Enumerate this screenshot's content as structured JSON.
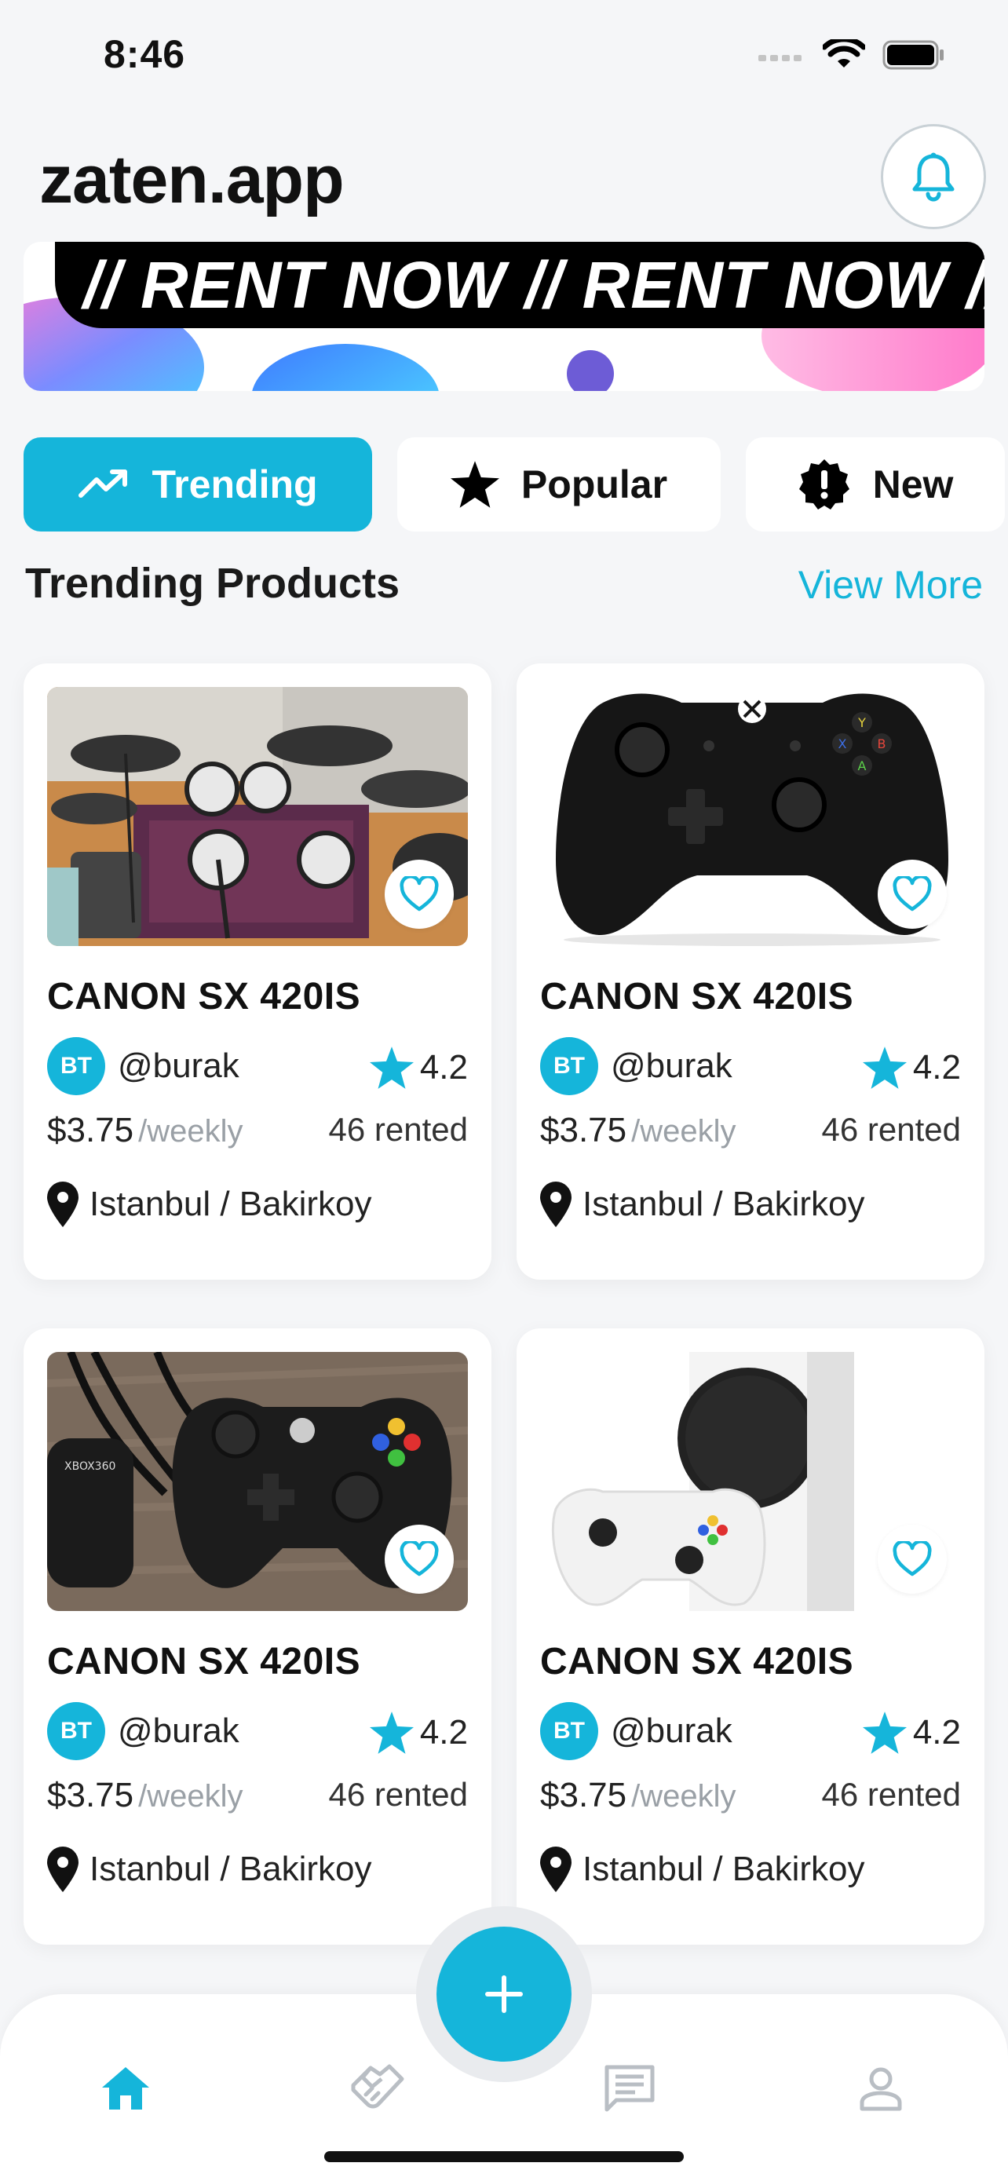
{
  "status_bar": {
    "time": "8:46"
  },
  "header": {
    "title": "zaten.app"
  },
  "banner": {
    "text": "// RENT NOW // RENT NOW //"
  },
  "filters": [
    {
      "label": "Trending",
      "icon": "trending-up-icon",
      "active": true
    },
    {
      "label": "Popular",
      "icon": "star-icon",
      "active": false
    },
    {
      "label": "New",
      "icon": "new-badge-icon",
      "active": false
    }
  ],
  "section": {
    "title": "Trending Products",
    "view_more": "View More"
  },
  "products": [
    {
      "name": "CANON SX 420IS",
      "avatar": "BT",
      "username": "@burak",
      "rating": "4.2",
      "price": "$3.75",
      "period": "/weekly",
      "rented": "46 rented",
      "location": "Istanbul / Bakirkoy",
      "image": "drum-kit"
    },
    {
      "name": "CANON SX 420IS",
      "avatar": "BT",
      "username": "@burak",
      "rating": "4.2",
      "price": "$3.75",
      "period": "/weekly",
      "rented": "46 rented",
      "location": "Istanbul / Bakirkoy",
      "image": "xbox-one-controller"
    },
    {
      "name": "CANON SX 420IS",
      "avatar": "BT",
      "username": "@burak",
      "rating": "4.2",
      "price": "$3.75",
      "period": "/weekly",
      "rented": "46 rented",
      "location": "Istanbul / Bakirkoy",
      "image": "xbox-360-controller"
    },
    {
      "name": "CANON SX 420IS",
      "avatar": "BT",
      "username": "@burak",
      "rating": "4.2",
      "price": "$3.75",
      "period": "/weekly",
      "rented": "46 rented",
      "location": "Istanbul / Bakirkoy",
      "image": "xbox-series-s"
    }
  ],
  "colors": {
    "accent": "#15b5da",
    "background": "#f5f6f8",
    "text": "#111111",
    "muted": "#9aa0a6"
  },
  "nav": [
    {
      "name": "home",
      "icon": "home-icon",
      "active": true
    },
    {
      "name": "rentals",
      "icon": "handshake-icon",
      "active": false
    },
    {
      "name": "messages",
      "icon": "chat-icon",
      "active": false
    },
    {
      "name": "profile",
      "icon": "person-icon",
      "active": false
    }
  ]
}
